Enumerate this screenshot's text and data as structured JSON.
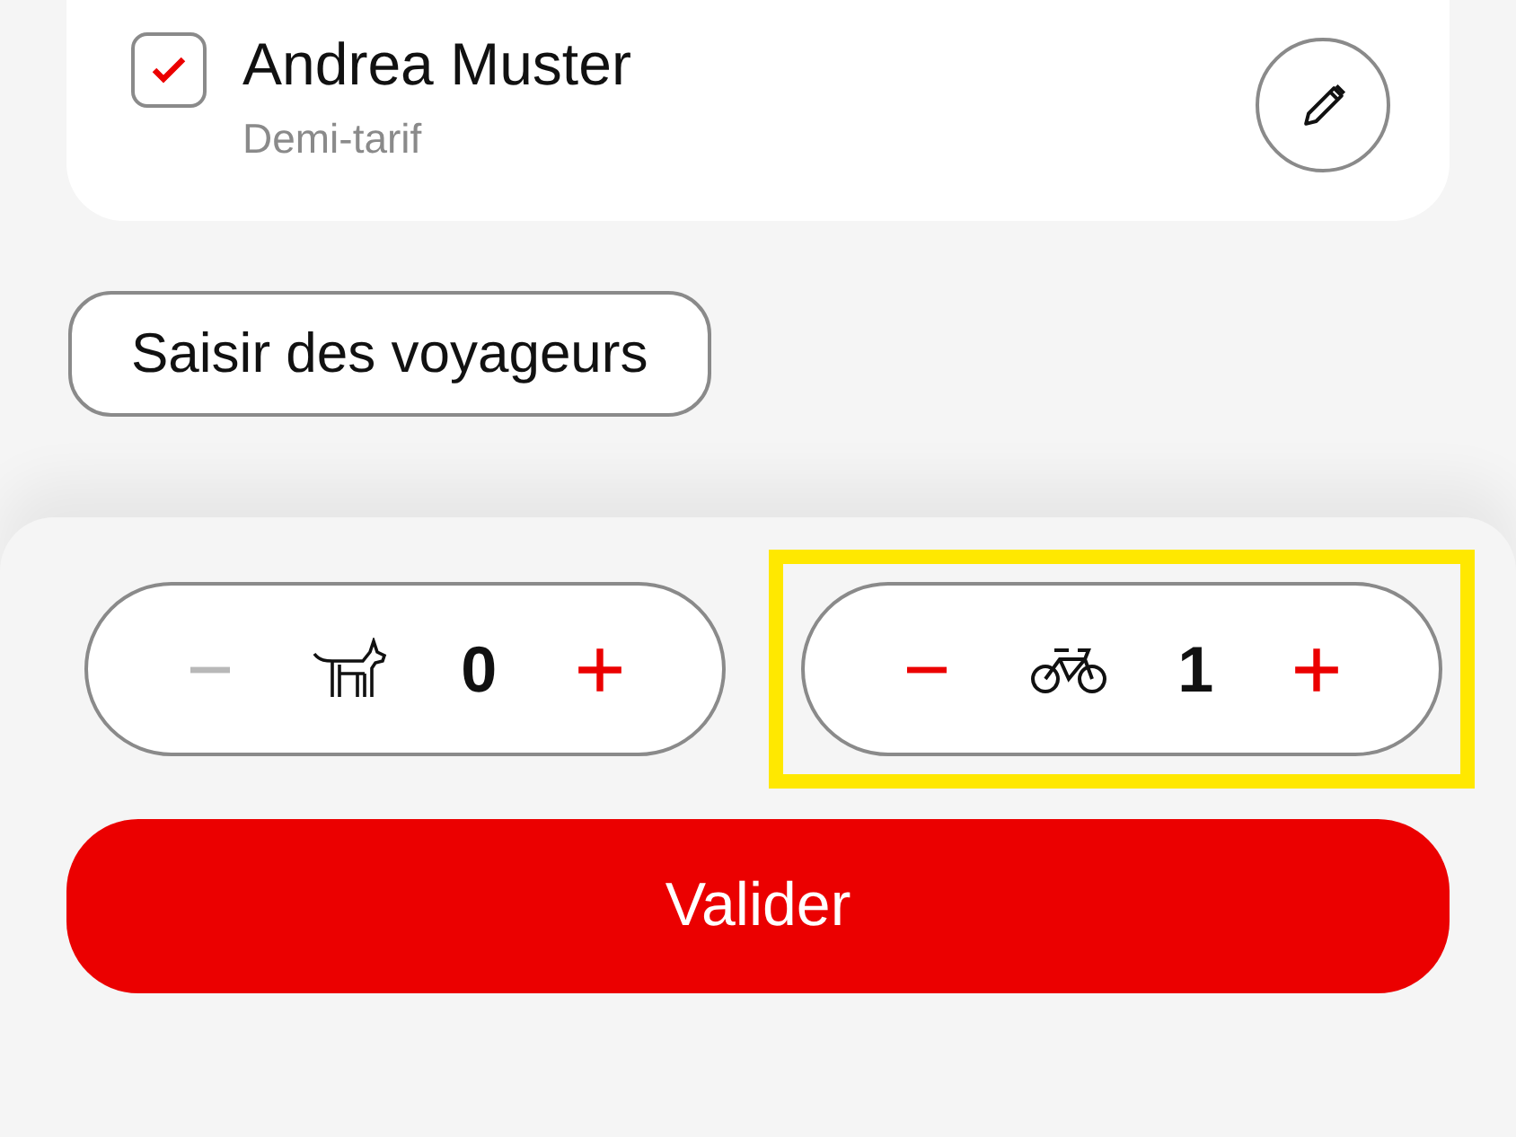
{
  "traveller": {
    "name": "Andrea Muster",
    "fare": "Demi-tarif",
    "checked": true
  },
  "add_button": "Saisir des voyageurs",
  "steppers": [
    {
      "kind": "dog",
      "count": "0",
      "minus_disabled": true,
      "highlighted": false
    },
    {
      "kind": "bike",
      "count": "1",
      "minus_disabled": false,
      "highlighted": true
    }
  ],
  "confirm_button": "Valider"
}
